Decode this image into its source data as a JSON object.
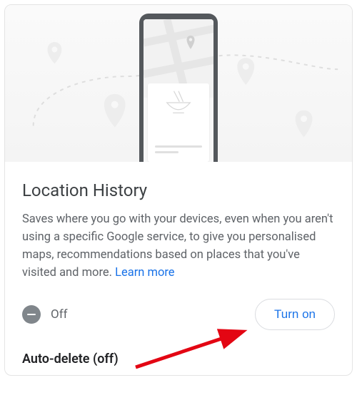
{
  "title": "Location History",
  "description": "Saves where you go with your devices, even when you aren't using a specific Google service, to give you personalised maps, recommendations based on places that you've visited and more. ",
  "learn_more_label": "Learn more",
  "status": {
    "label": "Off",
    "button_label": "Turn on"
  },
  "auto_delete_label": "Auto-delete (off)"
}
